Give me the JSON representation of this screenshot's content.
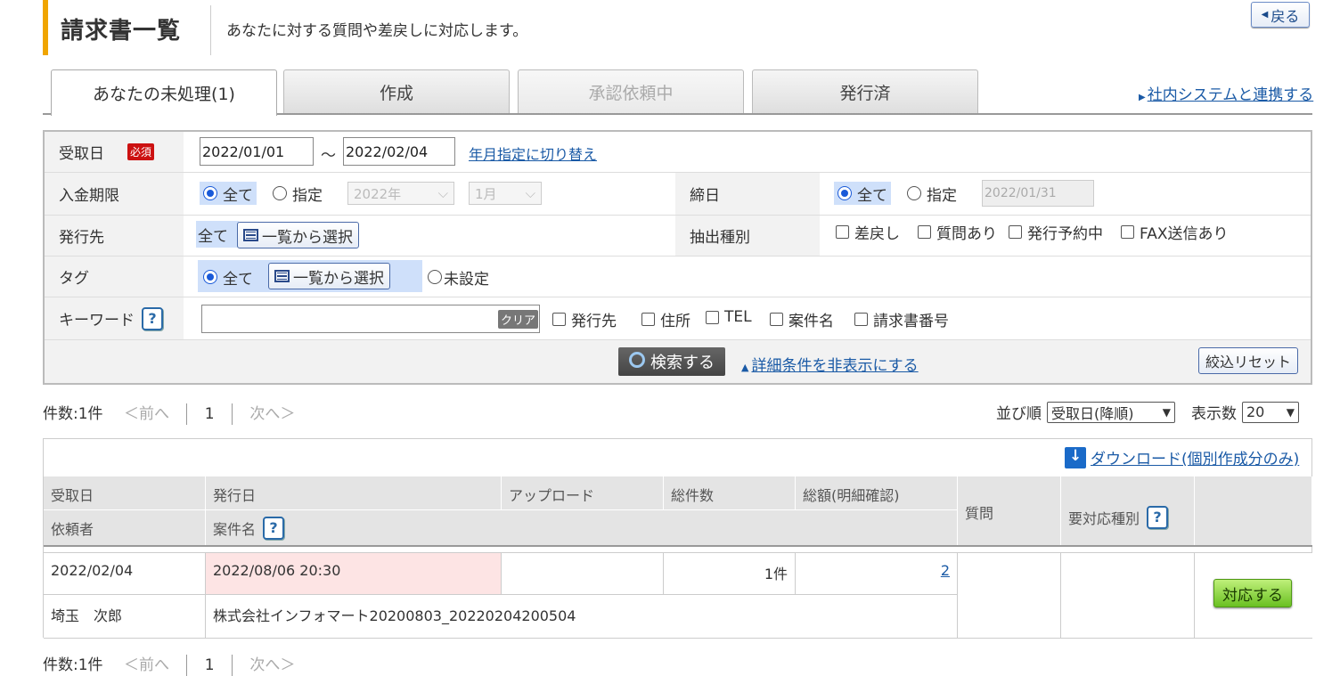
{
  "header": {
    "title": "請求書一覧",
    "description": "あなたに対する質問や差戻しに対応します。",
    "back_label": "戻る"
  },
  "tabs": [
    {
      "label": "あなたの未処理(1)",
      "state": "active"
    },
    {
      "label": "作成",
      "state": "normal"
    },
    {
      "label": "承認依頼中",
      "state": "disabled"
    },
    {
      "label": "発行済",
      "state": "normal"
    }
  ],
  "link_system": "社内システムと連携する",
  "filters": {
    "received": {
      "label": "受取日",
      "required": "必須",
      "from": "2022/01/01",
      "tilde": "～",
      "to": "2022/02/04",
      "toggle_link": "年月指定に切り替え"
    },
    "payment_due": {
      "label": "入金期限",
      "opt_all": "全て",
      "opt_specify": "指定",
      "year": "2022年",
      "month": "1月"
    },
    "closing_date": {
      "label": "締日",
      "opt_all": "全て",
      "opt_specify": "指定",
      "date": "2022/01/31"
    },
    "issuer": {
      "label": "発行先",
      "value": "全て",
      "select_btn": "一覧から選択"
    },
    "extract_type": {
      "label": "抽出種別",
      "options": [
        "差戻し",
        "質問あり",
        "発行予約中",
        "FAX送信あり"
      ]
    },
    "tag": {
      "label": "タグ",
      "opt_all": "全て",
      "select_btn": "一覧から選択",
      "opt_unset": "未設定"
    },
    "keyword": {
      "label": "キーワード",
      "clear": "クリア",
      "value": "",
      "options": [
        "発行先",
        "住所",
        "TEL",
        "案件名",
        "請求書番号"
      ]
    },
    "search_btn": "検索する",
    "hide_link": "詳細条件を非表示にする",
    "reset_btn": "絞込リセット"
  },
  "pager": {
    "count": "件数:1件",
    "prev": "＜前へ",
    "page": "1",
    "next": "次へ＞",
    "sort_label": "並び順",
    "sort_value": "受取日(降順)",
    "per_page_label": "表示数",
    "per_page_value": "20"
  },
  "table": {
    "download_link": "ダウンロード(個別作成分のみ)",
    "headers": {
      "received": "受取日",
      "issued": "発行日",
      "upload": "アップロード",
      "total_count": "総件数",
      "total_amount": "総額(明細確認)",
      "question": "質問",
      "response_type": "要対応種別",
      "requester": "依頼者",
      "subject": "案件名"
    },
    "rows": [
      {
        "received": "2022/02/04",
        "issued": "2022/08/06 20:30",
        "upload": "",
        "total_count": "1件",
        "total_amount": "2",
        "question": "",
        "response_type": "",
        "requester": "埼玉　次郎",
        "subject": "株式会社インフォマート20200803_20220204200504",
        "action": "対応する"
      }
    ]
  },
  "bottom_pager": {
    "count": "件数:1件",
    "prev": "＜前へ",
    "page": "1",
    "next": "次へ＞"
  }
}
